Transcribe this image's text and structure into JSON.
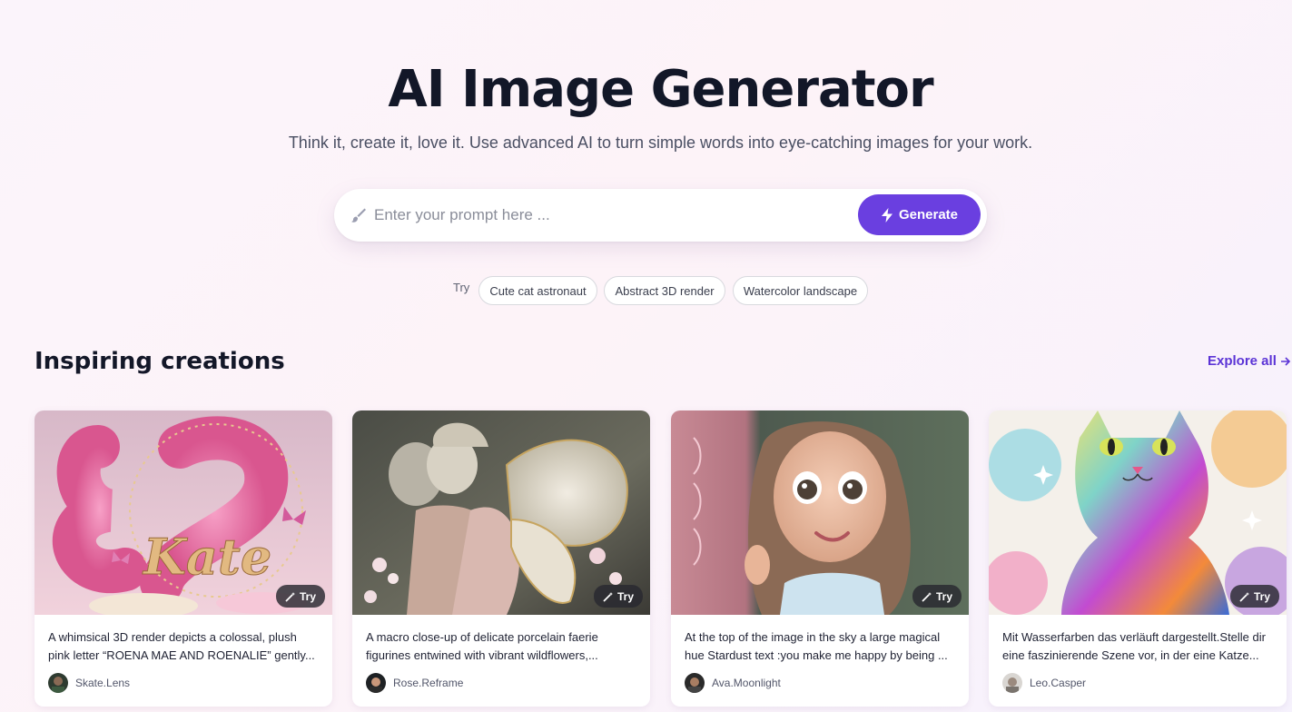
{
  "hero": {
    "title": "AI Image Generator",
    "subtitle": "Think it, create it, love it. Use advanced AI to turn simple words into eye-catching images for your work."
  },
  "prompt": {
    "placeholder": "Enter your prompt here ...",
    "value": "",
    "generate_label": "Generate",
    "icon": "brush-icon",
    "generate_icon": "bolt-icon"
  },
  "suggestions": {
    "label": "Try",
    "chips": [
      "Cute cat astronaut",
      "Abstract 3D render",
      "Watercolor landscape"
    ]
  },
  "gallery": {
    "title": "Inspiring creations",
    "explore_label": "Explore all",
    "explore_icon": "arrow-right-icon",
    "try_label": "Try",
    "cards": [
      {
        "description": "A whimsical 3D render depicts a colossal, plush pink letter “ROENA MAE AND ROENALIE” gently...",
        "author": "Skate.Lens"
      },
      {
        "description": "A macro close-up of delicate porcelain faerie figurines entwined with vibrant wildflowers,...",
        "author": "Rose.Reframe"
      },
      {
        "description": "At the top of the image in the sky a large magical hue Stardust text :you make me happy by being ...",
        "author": "Ava.Moonlight"
      },
      {
        "description": "Mit Wasserfarben das verläuft dargestellt.Stelle dir eine faszinierende Szene vor, in der eine Katze...",
        "author": "Leo.Casper"
      }
    ]
  },
  "colors": {
    "accent": "#6a3fe0",
    "link": "#5b34d6",
    "title": "#121728"
  }
}
